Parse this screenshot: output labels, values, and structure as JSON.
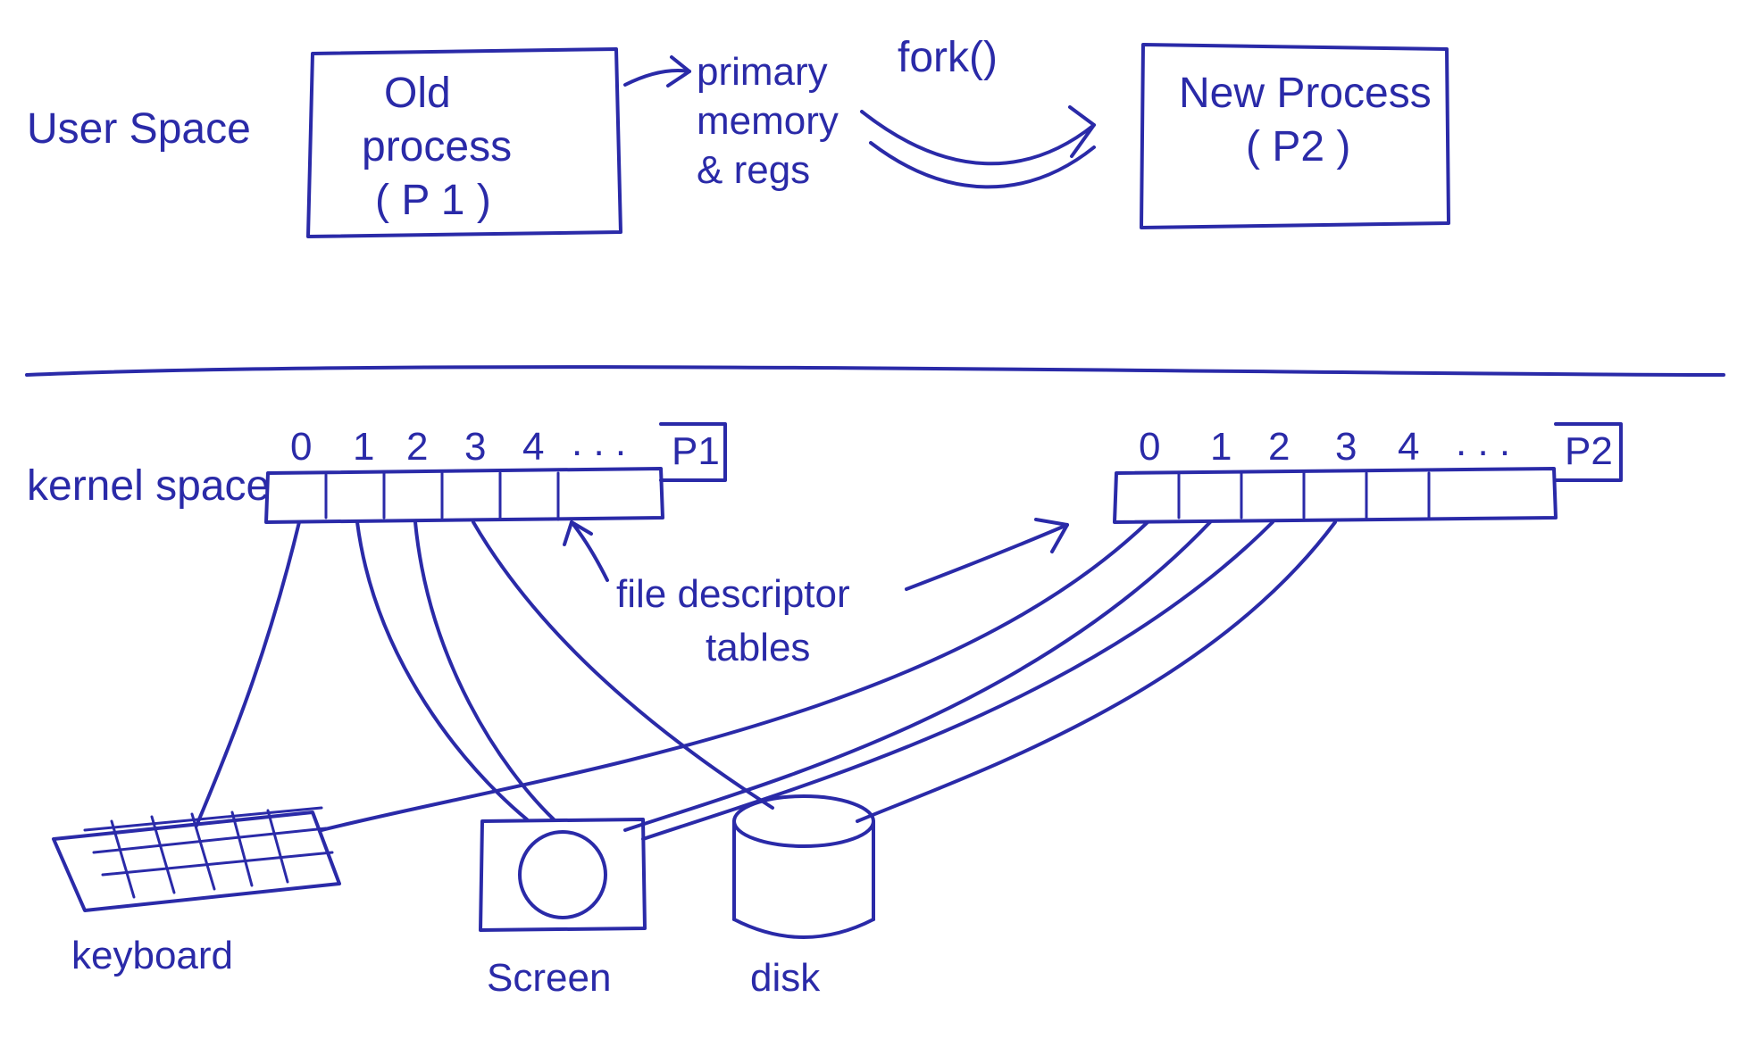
{
  "color": "#2a2aa8",
  "labels": {
    "user_space": "User Space",
    "kernel_space": "kernel space",
    "old_process_l1": "Old",
    "old_process_l2": "process",
    "old_process_l3": "( P 1 )",
    "new_process_l1": "New Process",
    "new_process_l2": "( P2 )",
    "fork": "fork()",
    "primary_l1": "primary",
    "primary_l2": "memory",
    "primary_l3": "& regs",
    "fd_tables_l1": "file descriptor",
    "fd_tables_l2": "tables",
    "keyboard": "keyboard",
    "screen": "Screen",
    "disk": "disk",
    "p1_tag": "P1",
    "p2_tag": "P2",
    "fd0": "0",
    "fd1": "1",
    "fd2": "2",
    "fd3": "3",
    "fd4": "4",
    "fd_ellipsis": ". . ."
  }
}
